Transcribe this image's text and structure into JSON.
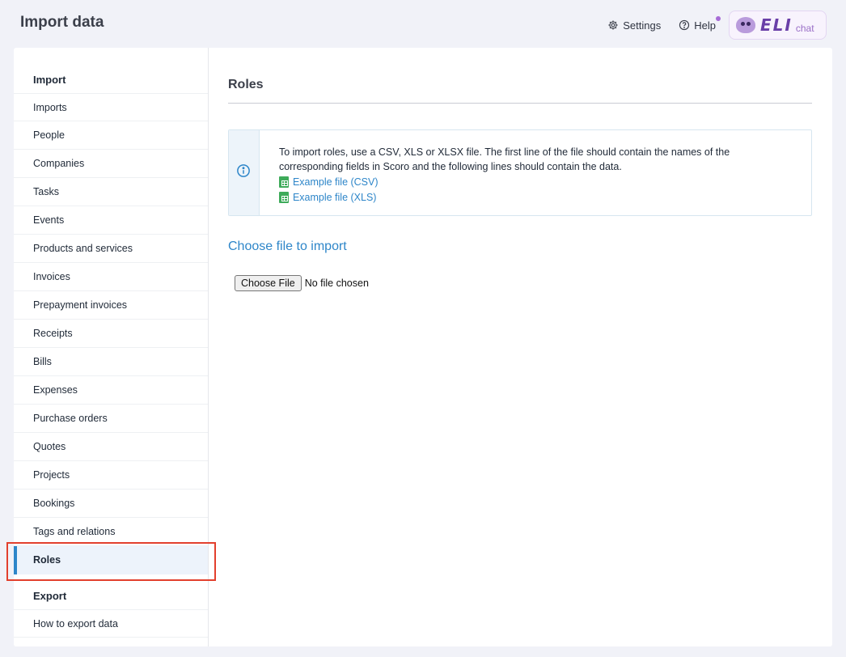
{
  "header": {
    "title": "Import data",
    "settings_label": "Settings",
    "help_label": "Help",
    "eli_logo_text": "ELI",
    "eli_chat_label": "chat",
    "help_dot_color": "#a66bd6"
  },
  "sidebar": {
    "import_heading": "Import",
    "import_items": [
      {
        "label": "Imports"
      },
      {
        "label": "People"
      },
      {
        "label": "Companies"
      },
      {
        "label": "Tasks"
      },
      {
        "label": "Events"
      },
      {
        "label": "Products and services"
      },
      {
        "label": "Invoices"
      },
      {
        "label": "Prepayment invoices"
      },
      {
        "label": "Receipts"
      },
      {
        "label": "Bills"
      },
      {
        "label": "Expenses"
      },
      {
        "label": "Purchase orders"
      },
      {
        "label": "Quotes"
      },
      {
        "label": "Projects"
      },
      {
        "label": "Bookings"
      },
      {
        "label": "Tags and relations"
      },
      {
        "label": "Roles",
        "active": true
      }
    ],
    "export_heading": "Export",
    "export_items": [
      {
        "label": "How to export data"
      }
    ],
    "active_accent_color": "#2e86c9"
  },
  "main": {
    "title": "Roles",
    "info": {
      "text": "To import roles, use a CSV, XLS or XLSX file. The first line of the file should contain the names of the corresponding fields in Scoro and the following lines should contain the data.",
      "links": [
        {
          "label": "Example file (CSV)"
        },
        {
          "label": "Example file (XLS)"
        }
      ],
      "icon": "info-icon"
    },
    "choose_title": "Choose file to import",
    "file_button_label": "Choose File",
    "file_status": "No file chosen",
    "link_color": "#2e86c9"
  }
}
